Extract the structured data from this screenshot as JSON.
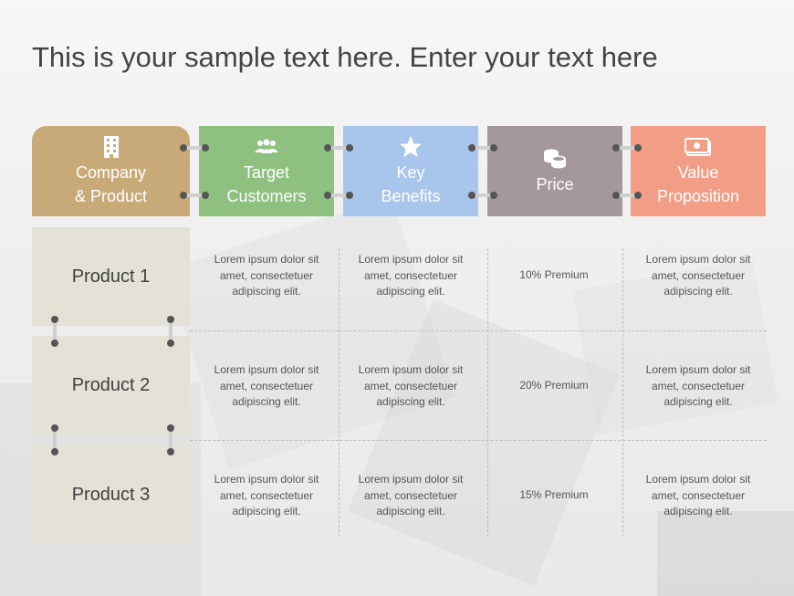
{
  "title": "This is your sample text here. Enter your text here",
  "headers": [
    {
      "line1": "Company",
      "line2": "& Product",
      "icon": "building-icon",
      "color": "#c8aa79"
    },
    {
      "line1": "Target",
      "line2": "Customers",
      "icon": "people-icon",
      "color": "#8ec07f"
    },
    {
      "line1": "Key",
      "line2": "Benefits",
      "icon": "star-icon",
      "color": "#a8c5eb"
    },
    {
      "line1": "Price",
      "line2": "",
      "icon": "coins-icon",
      "color": "#a5989c"
    },
    {
      "line1": "Value",
      "line2": "Proposition",
      "icon": "money-icon",
      "color": "#f29e87"
    }
  ],
  "rows": [
    {
      "product": "Product 1",
      "target": "Lorem ipsum dolor sit amet, consectetuer adipiscing elit.",
      "benefits": "Lorem ipsum dolor sit amet, consectetuer adipiscing elit.",
      "price": "10% Premium",
      "value": "Lorem ipsum dolor sit amet, consectetuer adipiscing elit."
    },
    {
      "product": "Product 2",
      "target": "Lorem ipsum dolor sit amet, consectetuer adipiscing elit.",
      "benefits": "Lorem ipsum dolor sit amet, consectetuer adipiscing elit.",
      "price": "20% Premium",
      "value": "Lorem ipsum dolor sit amet, consectetuer adipiscing elit."
    },
    {
      "product": "Product 3",
      "target": "Lorem ipsum dolor sit amet, consectetuer adipiscing elit.",
      "benefits": "Lorem ipsum dolor sit amet, consectetuer adipiscing elit.",
      "price": "15% Premium",
      "value": "Lorem ipsum dolor sit amet, consectetuer adipiscing elit."
    }
  ]
}
